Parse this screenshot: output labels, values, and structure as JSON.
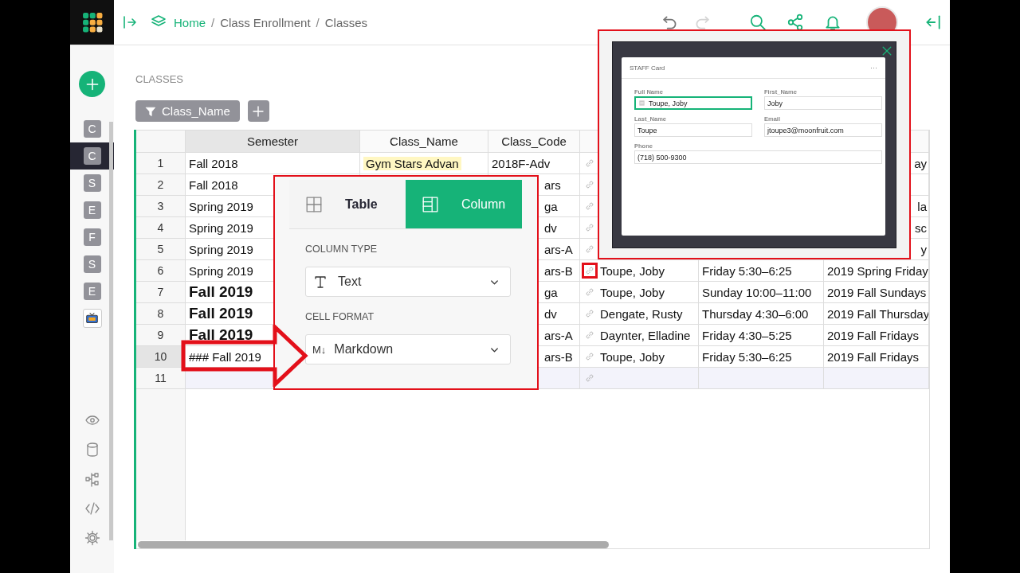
{
  "topbar": {
    "breadcrumbs": {
      "items": [
        "Home",
        "Class Enrollment",
        "Classes"
      ],
      "separator": "/"
    },
    "history_buttons": [
      {
        "kind": "undo",
        "disabled": false
      },
      {
        "kind": "redo",
        "disabled": true
      }
    ]
  },
  "sidebar": {
    "pages": [
      {
        "kind": "letter",
        "letter": "C",
        "selected": false
      },
      {
        "kind": "letter",
        "letter": "C",
        "selected": true
      },
      {
        "kind": "letter",
        "letter": "S",
        "selected": false
      },
      {
        "kind": "letter",
        "letter": "E",
        "selected": false
      },
      {
        "kind": "letter",
        "letter": "F",
        "selected": false
      },
      {
        "kind": "letter",
        "letter": "S",
        "selected": false
      },
      {
        "kind": "letter",
        "letter": "E",
        "selected": false
      },
      {
        "kind": "widget",
        "selected": false
      }
    ]
  },
  "section": {
    "title": "CLASSES",
    "filter": "Class_Name"
  },
  "table": {
    "columns": [
      {
        "label": "Semester",
        "selected": true
      },
      {
        "label": "Class_Name",
        "selected": false
      },
      {
        "label": "Class_Code",
        "selected": false
      }
    ],
    "rows": [
      {
        "number": "1",
        "kind": "data",
        "selected": false,
        "cells": [
          {
            "text": "Fall 2018",
            "kind": "plain"
          },
          {
            "text": "Gym Stars Advan",
            "kind": "highlight"
          },
          {
            "text": "2018F-Adv",
            "kind": "plain"
          },
          {
            "kind": "link",
            "marked": false
          },
          {},
          {
            "text": "ay",
            "kind": "tail"
          }
        ]
      },
      {
        "number": "2",
        "kind": "data",
        "selected": false,
        "cells": [
          {
            "text": "Fall 2018",
            "kind": "plain"
          },
          {},
          {
            "text": "ars",
            "kind": "tail"
          },
          {
            "kind": "link",
            "marked": false
          },
          {},
          {}
        ]
      },
      {
        "number": "3",
        "kind": "data",
        "selected": false,
        "cells": [
          {
            "text": "Spring 2019",
            "kind": "plain"
          },
          {},
          {
            "text": "ga",
            "kind": "tail"
          },
          {
            "kind": "link",
            "marked": false
          },
          {},
          {
            "text": "la",
            "kind": "tail"
          }
        ]
      },
      {
        "number": "4",
        "kind": "data",
        "selected": false,
        "cells": [
          {
            "text": "Spring 2019",
            "kind": "plain"
          },
          {},
          {
            "text": "dv",
            "kind": "tail"
          },
          {
            "kind": "link",
            "marked": false
          },
          {},
          {
            "text": "sc",
            "kind": "tail"
          }
        ]
      },
      {
        "number": "5",
        "kind": "data",
        "selected": false,
        "cells": [
          {
            "text": "Spring 2019",
            "kind": "plain"
          },
          {},
          {
            "text": "ars-A",
            "kind": "tail"
          },
          {
            "kind": "link",
            "marked": false
          },
          {},
          {
            "text": "y",
            "kind": "tail"
          }
        ]
      },
      {
        "number": "6",
        "kind": "data",
        "selected": false,
        "cells": [
          {
            "text": "Spring 2019",
            "kind": "plain"
          },
          {},
          {
            "text": "ars-B",
            "kind": "tail"
          },
          {
            "text": "Toupe, Joby",
            "kind": "link",
            "marked": true
          },
          {
            "text": "Friday 5:30–6:25",
            "kind": "plain"
          },
          {
            "text": "2019 Spring Friday",
            "kind": "plain"
          }
        ]
      },
      {
        "number": "7",
        "kind": "data",
        "selected": false,
        "cells": [
          {
            "text": "Fall 2019",
            "kind": "heading"
          },
          {},
          {
            "text": "ga",
            "kind": "tail"
          },
          {
            "text": "Toupe, Joby",
            "kind": "link",
            "marked": false
          },
          {
            "text": "Sunday 10:00–11:00",
            "kind": "plain"
          },
          {
            "text": "2019 Fall Sundays",
            "kind": "plain"
          }
        ]
      },
      {
        "number": "8",
        "kind": "data",
        "selected": false,
        "cells": [
          {
            "text": "Fall 2019",
            "kind": "heading"
          },
          {},
          {
            "text": "dv",
            "kind": "tail"
          },
          {
            "text": "Dengate, Rusty",
            "kind": "link",
            "marked": false
          },
          {
            "text": "Thursday 4:30–6:00",
            "kind": "plain"
          },
          {
            "text": "2019 Fall Thursday",
            "kind": "plain"
          }
        ]
      },
      {
        "number": "9",
        "kind": "data",
        "selected": false,
        "cells": [
          {
            "text": "Fall 2019",
            "kind": "heading"
          },
          {},
          {
            "text": "ars-A",
            "kind": "tail"
          },
          {
            "text": "Daynter, Elladine",
            "kind": "link",
            "marked": false
          },
          {
            "text": "Friday 4:30–5:25",
            "kind": "plain"
          },
          {
            "text": "2019 Fall Fridays",
            "kind": "plain"
          }
        ]
      },
      {
        "number": "10",
        "kind": "data",
        "selected": true,
        "cells": [
          {
            "text": "### Fall 2019",
            "kind": "plain"
          },
          {},
          {
            "text": "ars-B",
            "kind": "tail"
          },
          {
            "text": "Toupe, Joby",
            "kind": "link",
            "marked": false
          },
          {
            "text": "Friday 5:30–6:25",
            "kind": "plain"
          },
          {
            "text": "2019 Fall Fridays",
            "kind": "plain"
          }
        ]
      },
      {
        "number": "11",
        "kind": "add",
        "selected": false,
        "cells": [
          {},
          {},
          {},
          {
            "kind": "link",
            "marked": false
          },
          {},
          {}
        ]
      }
    ]
  },
  "column_panel": {
    "tabs": [
      {
        "label": "Table",
        "kind": "table",
        "selected": false
      },
      {
        "label": "Column",
        "kind": "column",
        "selected": true
      }
    ],
    "fields": [
      {
        "label": "COLUMN TYPE",
        "kind": "type",
        "value": "Text"
      },
      {
        "label": "CELL FORMAT",
        "kind": "format",
        "icon_text": "M↓",
        "value": "Markdown"
      }
    ]
  },
  "staff_card": {
    "title": "STAFF Card",
    "menu": "···",
    "fields": [
      {
        "label": "Full Name",
        "value": "Toupe, Joby",
        "kind": "reference",
        "focused": true,
        "wide": false
      },
      {
        "label": "First_Name",
        "value": "Joby",
        "kind": "text",
        "focused": false,
        "wide": false
      },
      {
        "label": "Last_Name",
        "value": "Toupe",
        "kind": "text",
        "focused": false,
        "wide": false
      },
      {
        "label": "Email",
        "value": "jtoupe3@moonfruit.com",
        "kind": "text",
        "focused": false,
        "wide": false
      },
      {
        "label": "Phone",
        "value": "(718) 500-9300",
        "kind": "text",
        "focused": false,
        "wide": true
      }
    ]
  }
}
